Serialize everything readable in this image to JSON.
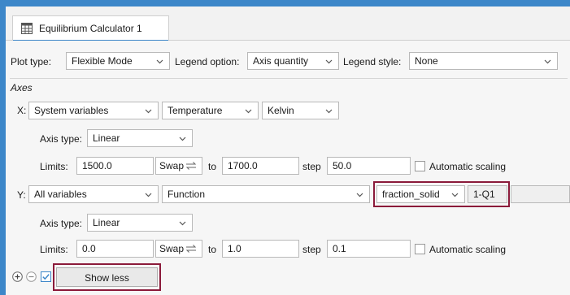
{
  "tab": {
    "icon": "calculator-grid-icon",
    "title": "Equilibrium Calculator 1"
  },
  "toolbar": {
    "plot_type_label": "Plot type:",
    "plot_type_value": "Flexible Mode",
    "legend_option_label": "Legend option:",
    "legend_option_value": "Axis quantity",
    "legend_style_label": "Legend style:",
    "legend_style_value": "None"
  },
  "axes": {
    "section_title": "Axes",
    "x": {
      "label": "X:",
      "variable_type": "System variables",
      "quantity": "Temperature",
      "unit": "Kelvin",
      "axis_type_label": "Axis type:",
      "axis_type": "Linear",
      "limits_label": "Limits:",
      "min": "1500.0",
      "swap_label": "Swap",
      "to_label": "to",
      "max": "1700.0",
      "step_label": "step",
      "step": "50.0",
      "auto_scaling_label": "Automatic scaling",
      "auto_scaling_checked": false
    },
    "y": {
      "label": "Y:",
      "variable_type": "All variables",
      "quantity": "Function",
      "function_name": "fraction_solid",
      "function_expr": "1-Q1",
      "axis_type_label": "Axis type:",
      "axis_type": "Linear",
      "limits_label": "Limits:",
      "min": "0.0",
      "swap_label": "Swap",
      "to_label": "to",
      "max": "1.0",
      "step_label": "step",
      "step": "0.1",
      "auto_scaling_label": "Automatic scaling",
      "auto_scaling_checked": false
    }
  },
  "footer": {
    "show_less_label": "Show less",
    "toggle_checked": true
  },
  "colors": {
    "accent": "#3d87c9",
    "highlight": "#8b1a3a"
  },
  "icons": {
    "add": "plus-circle-icon",
    "remove": "minus-circle-icon",
    "dropdown": "chevron-down-icon",
    "swap": "swap-icon"
  }
}
